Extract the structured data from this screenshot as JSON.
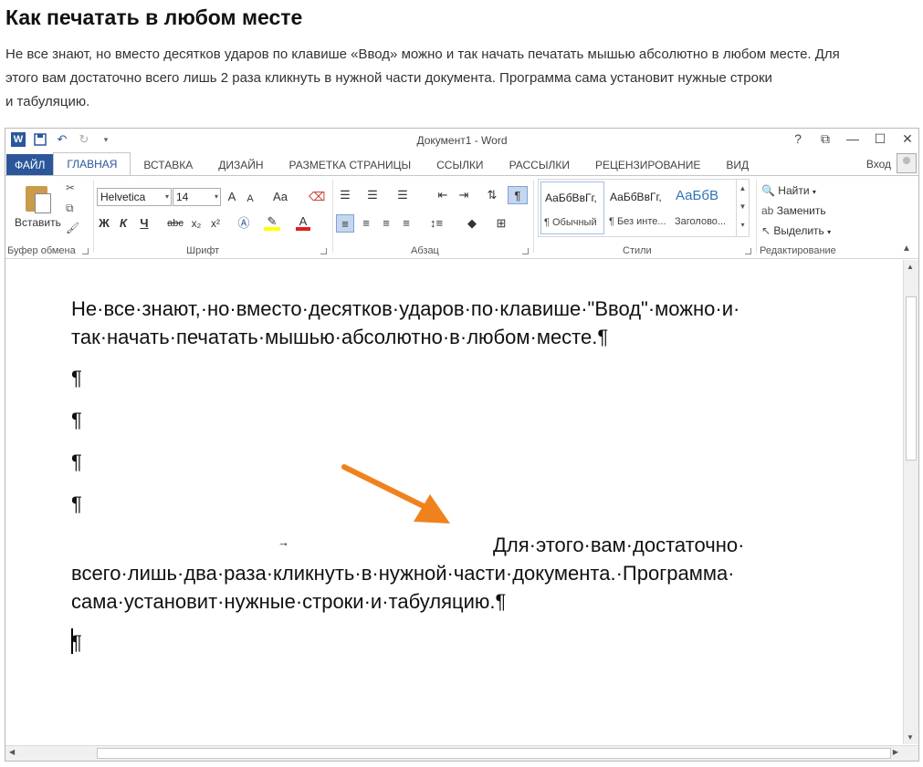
{
  "article": {
    "title": "Как печатать в любом месте",
    "line1": "Не все знают, но вместо десятков ударов по клавише «Ввод» можно и так начать печатать мышью абсолютно в любом месте. Для",
    "line2": "этого вам достаточно всего лишь 2 раза кликнуть в нужной части документа. Программа сама установит нужные строки",
    "line3": "и табуляцию."
  },
  "window": {
    "title": "Документ1 - Word",
    "controls": [
      "?",
      "⧉",
      "—",
      "☐",
      "✕"
    ],
    "signin": "Вход"
  },
  "tabs": [
    "ФАЙЛ",
    "ГЛАВНАЯ",
    "ВСТАВКА",
    "ДИЗАЙН",
    "РАЗМЕТКА СТРАНИЦЫ",
    "ССЫЛКИ",
    "РАССЫЛКИ",
    "РЕЦЕНЗИРОВАНИЕ",
    "ВИД"
  ],
  "ribbon": {
    "clipboard": {
      "paste_label": "Вставить",
      "group_label": "Буфер обмена"
    },
    "font": {
      "font_name": "Helvetica",
      "font_size": "14",
      "grow": "A",
      "shrink": "A",
      "case": "Aa",
      "bold": "Ж",
      "italic": "К",
      "underline": "Ч",
      "strike": "abc",
      "subscript": "x₂",
      "superscript": "x²",
      "group_label": "Шрифт"
    },
    "paragraph": {
      "group_label": "Абзац",
      "pilcrow": "¶"
    },
    "styles": {
      "items": [
        {
          "sample": "АаБбВвГг,",
          "name": "¶ Обычный"
        },
        {
          "sample": "АаБбВвГг,",
          "name": "¶ Без инте..."
        },
        {
          "sample": "АаБбВ",
          "name": "Заголово..."
        }
      ],
      "group_label": "Стили"
    },
    "editing": {
      "find": "Найти",
      "replace": "Заменить",
      "select": "Выделить",
      "group_label": "Редактирование"
    }
  },
  "document": {
    "p1_line1": "Не·все·знают,·но·вместо·десятков·ударов·по·клавише·\"Ввод\"·можно·и·",
    "p1_line2": "так·начать·печатать·мышью·абсолютно·в·любом·месте.¶",
    "empty_mark": "¶",
    "tab_arrow": "→",
    "p2_line1": "Для·этого·вам·достаточно·",
    "p2_line2": "всего·лишь·два·раза·кликнуть·в·нужной·части·документа.·Программа·",
    "p2_line3": "сама·установит·нужные·строки·и·табуляцию.¶",
    "last_mark": "¶"
  },
  "colors": {
    "accent": "#2b579a",
    "arrow": "#f0821e"
  }
}
